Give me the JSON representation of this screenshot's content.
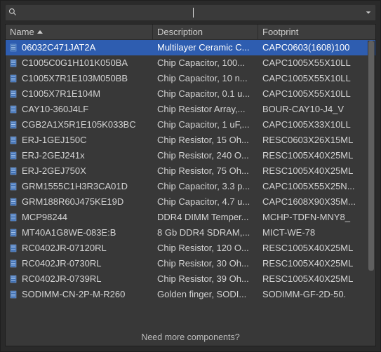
{
  "search": {
    "value": "",
    "placeholder": ""
  },
  "columns": {
    "name": "Name",
    "description": "Description",
    "footprint": "Footprint"
  },
  "selected_index": 0,
  "rows": [
    {
      "name": "06032C471JAT2A",
      "description": "Multilayer Ceramic C...",
      "footprint": "CAPC0603(1608)100"
    },
    {
      "name": "C1005C0G1H101K050BA",
      "description": "Chip Capacitor, 100...",
      "footprint": "CAPC1005X55X10LL"
    },
    {
      "name": "C1005X7R1E103M050BB",
      "description": "Chip Capacitor, 10 n...",
      "footprint": "CAPC1005X55X10LL"
    },
    {
      "name": "C1005X7R1E104M",
      "description": "Chip Capacitor, 0.1 u...",
      "footprint": "CAPC1005X55X10LL"
    },
    {
      "name": "CAY10-360J4LF",
      "description": "Chip Resistor Array,...",
      "footprint": "BOUR-CAY10-J4_V"
    },
    {
      "name": "CGB2A1X5R1E105K033BC",
      "description": "Chip Capacitor, 1 uF,...",
      "footprint": "CAPC1005X33X10LL"
    },
    {
      "name": "ERJ-1GEJ150C",
      "description": "Chip Resistor, 15 Oh...",
      "footprint": "RESC0603X26X15ML"
    },
    {
      "name": "ERJ-2GEJ241x",
      "description": "Chip Resistor, 240 O...",
      "footprint": "RESC1005X40X25ML"
    },
    {
      "name": "ERJ-2GEJ750X",
      "description": "Chip Resistor, 75 Oh...",
      "footprint": "RESC1005X40X25ML"
    },
    {
      "name": "GRM1555C1H3R3CA01D",
      "description": "Chip Capacitor, 3.3 p...",
      "footprint": "CAPC1005X55X25N..."
    },
    {
      "name": "GRM188R60J475KE19D",
      "description": "Chip Capacitor, 4.7 u...",
      "footprint": "CAPC1608X90X35M..."
    },
    {
      "name": "MCP98244",
      "description": "DDR4 DIMM Temper...",
      "footprint": "MCHP-TDFN-MNY8_"
    },
    {
      "name": "MT40A1G8WE-083E:B",
      "description": "8 Gb DDR4 SDRAM,...",
      "footprint": "MICT-WE-78"
    },
    {
      "name": "RC0402JR-07120RL",
      "description": "Chip Resistor, 120 O...",
      "footprint": "RESC1005X40X25ML"
    },
    {
      "name": "RC0402JR-0730RL",
      "description": "Chip Resistor, 30 Oh...",
      "footprint": "RESC1005X40X25ML"
    },
    {
      "name": "RC0402JR-0739RL",
      "description": "Chip Resistor, 39 Oh...",
      "footprint": "RESC1005X40X25ML"
    },
    {
      "name": "SODIMM-CN-2P-M-R260",
      "description": "Golden finger, SODI...",
      "footprint": "SODIMM-GF-2D-50."
    }
  ],
  "footer": {
    "more_label": "Need more components?"
  }
}
